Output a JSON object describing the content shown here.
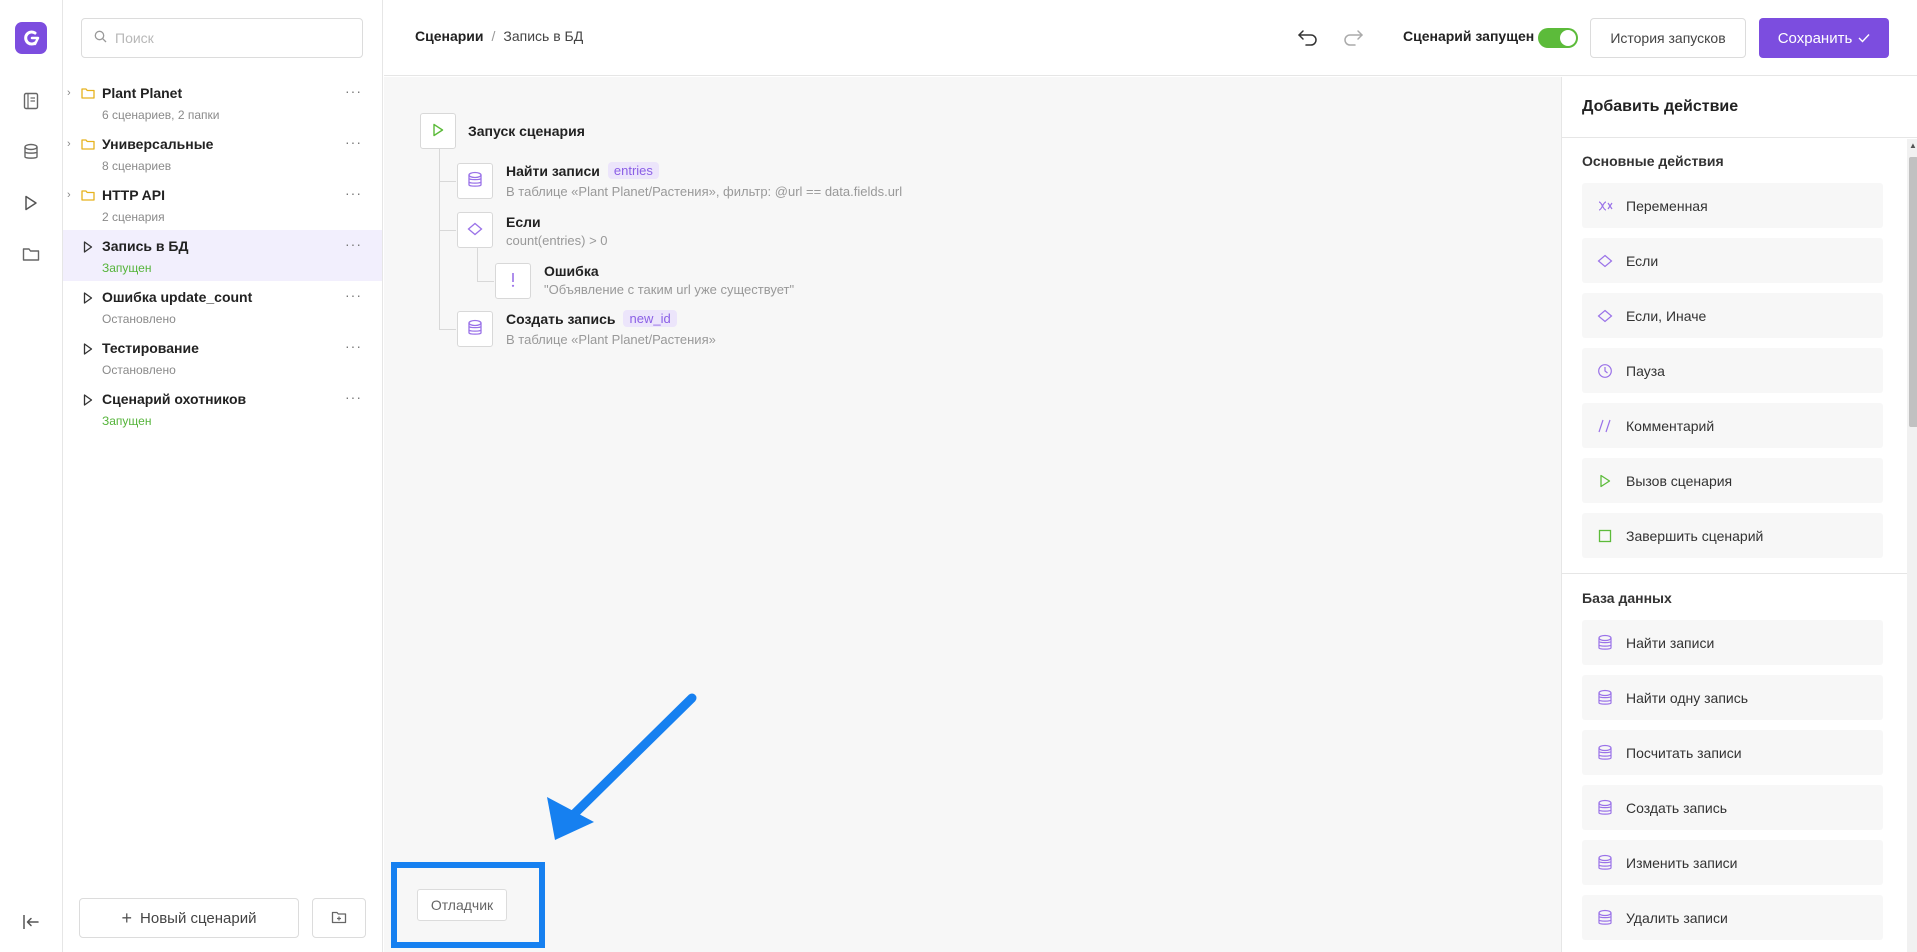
{
  "search": {
    "placeholder": "Поиск"
  },
  "tree": [
    {
      "name": "Plant Planet",
      "sub": "6 сценариев, 2 папки",
      "kind": "folder",
      "active": false,
      "status": ""
    },
    {
      "name": "Универсальные",
      "sub": "8 сценариев",
      "kind": "folder",
      "active": false,
      "status": ""
    },
    {
      "name": "HTTP API",
      "sub": "2 сценария",
      "kind": "folder",
      "active": false,
      "status": ""
    },
    {
      "name": "Запись в БД",
      "sub": "Запущен",
      "kind": "scenario",
      "active": true,
      "status": "running"
    },
    {
      "name": "Ошибка update_count",
      "sub": "Остановлено",
      "kind": "scenario",
      "active": false,
      "status": "stopped"
    },
    {
      "name": "Тестирование",
      "sub": "Остановлено",
      "kind": "scenario",
      "active": false,
      "status": "stopped"
    },
    {
      "name": "Сценарий охотников",
      "sub": "Запущен",
      "kind": "scenario",
      "active": false,
      "status": "running"
    }
  ],
  "sidebar_footer": {
    "new_label": "Новый сценарий"
  },
  "breadcrumb": {
    "root": "Сценарии",
    "separator": "/",
    "current": "Запись в БД"
  },
  "header": {
    "run_label": "Сценарий запущен",
    "running": true,
    "history_label": "История запусков",
    "save_label": "Сохранить"
  },
  "flow": {
    "start": {
      "title": "Запуск сценария"
    },
    "find": {
      "title": "Найти записи",
      "tag": "entries",
      "sub": "В таблице «Plant Planet/Растения», фильтр: @url == data.fields.url"
    },
    "if": {
      "title": "Если",
      "sub": "count(entries) > 0"
    },
    "error": {
      "title": "Ошибка",
      "sub": "\"Объявление с таким url уже существует\""
    },
    "create": {
      "title": "Создать запись",
      "tag": "new_id",
      "sub": "В таблице «Plant Planet/Растения»"
    }
  },
  "debugger": {
    "label": "Отладчик"
  },
  "panel": {
    "title": "Добавить действие",
    "basic_title": "Основные действия",
    "basic": [
      {
        "label": "Переменная",
        "icon": "variable-icon"
      },
      {
        "label": "Если",
        "icon": "diamond-icon"
      },
      {
        "label": "Если, Иначе",
        "icon": "diamond-icon"
      },
      {
        "label": "Пауза",
        "icon": "clock-icon"
      },
      {
        "label": "Комментарий",
        "icon": "comment-icon"
      },
      {
        "label": "Вызов сценария",
        "icon": "play-icon"
      },
      {
        "label": "Завершить сценарий",
        "icon": "stop-icon"
      }
    ],
    "db_title": "База данных",
    "db": [
      {
        "label": "Найти записи",
        "icon": "database-icon"
      },
      {
        "label": "Найти одну запись",
        "icon": "database-icon"
      },
      {
        "label": "Посчитать записи",
        "icon": "database-icon"
      },
      {
        "label": "Создать запись",
        "icon": "database-icon"
      },
      {
        "label": "Изменить записи",
        "icon": "database-icon"
      },
      {
        "label": "Удалить записи",
        "icon": "database-icon"
      }
    ]
  },
  "colors": {
    "accent": "#7c4ddf",
    "success": "#5cbb3a",
    "highlight": "#1680f0"
  }
}
